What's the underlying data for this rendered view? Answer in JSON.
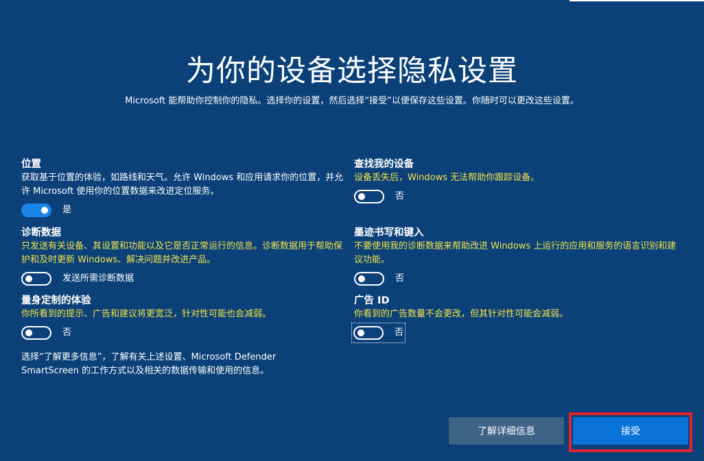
{
  "header": {
    "title": "为你的设备选择隐私设置",
    "subtitle": "Microsoft 能帮助你控制你的隐私。选择你的设置，然后选择“接受”以便保存这些设置。你随时可以更改这些设置。"
  },
  "settings": {
    "location": {
      "title": "位置",
      "desc": "获取基于位置的体验，如路线和天气。允许 Windows 和应用请求你的位置，并允许 Microsoft 使用你的位置数据来改进定位服务。",
      "state_label": "是",
      "on": true
    },
    "find_device": {
      "title": "查找我的设备",
      "desc": "设备丢失后，Windows 无法帮助你跟踪设备。",
      "state_label": "否",
      "on": false
    },
    "diagnostics": {
      "title": "诊断数据",
      "desc": "只发送有关设备、其设置和功能以及它是否正常运行的信息。诊断数据用于帮助保护和及时更新 Windows、解决问题并改进产品。",
      "state_label": "发送所需诊断数据",
      "on": false
    },
    "inking": {
      "title": "墨迹书写和键入",
      "desc": "不要使用我的诊断数据来帮助改进 Windows 上运行的应用和服务的语言识别和建议功能。",
      "state_label": "否",
      "on": false
    },
    "tailored": {
      "title": "量身定制的体验",
      "desc": "你所看到的提示、广告和建议将更宽泛，针对性可能也会减弱。",
      "state_label": "否",
      "on": false
    },
    "advertising_id": {
      "title": "广告 ID",
      "desc": "你看到的广告数量不会更改，但其针对性可能会减弱。",
      "state_label": "否",
      "on": false
    }
  },
  "footnote": "选择“了解更多信息”，了解有关上述设置、Microsoft Defender SmartScreen 的工作方式以及相关的数据传输和使用的信息。",
  "buttons": {
    "learn_more": "了解详细信息",
    "accept": "接受"
  },
  "colors": {
    "background": "#0b4178",
    "desc_highlight": "#f4e34a",
    "toggle_on": "#1a86e8",
    "accept_button": "#0a73d9",
    "learn_more_button": "#3d6386",
    "highlight_box": "#e2242d"
  }
}
